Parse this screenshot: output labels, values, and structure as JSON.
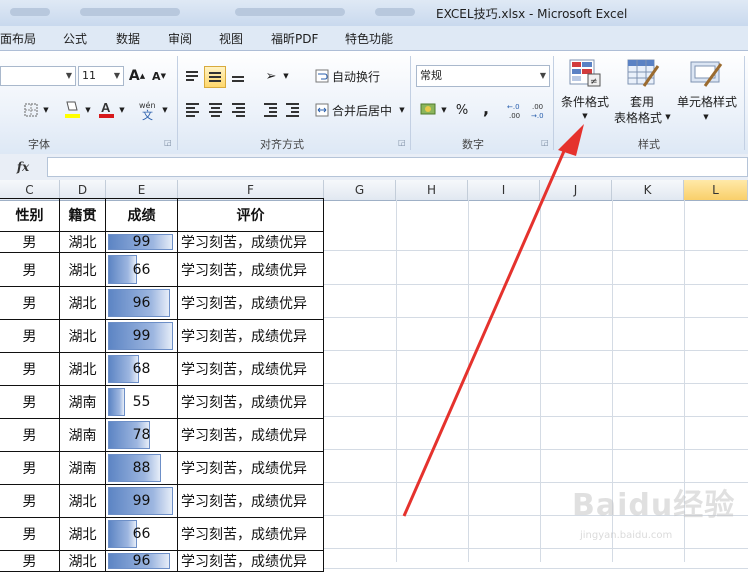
{
  "window": {
    "title": "EXCEL技巧.xlsx - Microsoft Excel"
  },
  "menu": [
    "面布局",
    "公式",
    "数据",
    "审阅",
    "视图",
    "福昕PDF",
    "特色功能"
  ],
  "font": {
    "size": "11",
    "grow": "A",
    "shrink": "A",
    "group_label": "字体"
  },
  "alignment": {
    "wrap_label": "自动换行",
    "merge_label": "合并后居中",
    "group_label": "对齐方式"
  },
  "number": {
    "format_value": "常规",
    "percent": "%",
    "comma": ",",
    "group_label": "数字"
  },
  "styles": {
    "conditional_label": "条件格式",
    "table_label_1": "套用",
    "table_label_2": "表格格式",
    "cell_styles_label": "单元格样式",
    "group_label": "样式"
  },
  "formula_bar": {
    "fx": "fx",
    "value": ""
  },
  "columns": [
    "C",
    "D",
    "E",
    "F",
    "G",
    "H",
    "I",
    "J",
    "K",
    "L"
  ],
  "table": {
    "headers": [
      "性别",
      "籍贯",
      "成绩",
      "评价"
    ],
    "rows": [
      [
        "男",
        "湖北",
        "99",
        "学习刻苦，成绩优异"
      ],
      [
        "男",
        "湖北",
        "66",
        "学习刻苦，成绩优异"
      ],
      [
        "男",
        "湖北",
        "96",
        "学习刻苦，成绩优异"
      ],
      [
        "男",
        "湖北",
        "99",
        "学习刻苦，成绩优异"
      ],
      [
        "男",
        "湖北",
        "68",
        "学习刻苦，成绩优异"
      ],
      [
        "男",
        "湖南",
        "55",
        "学习刻苦，成绩优异"
      ],
      [
        "男",
        "湖南",
        "78",
        "学习刻苦，成绩优异"
      ],
      [
        "男",
        "湖南",
        "88",
        "学习刻苦，成绩优异"
      ],
      [
        "男",
        "湖北",
        "99",
        "学习刻苦，成绩优异"
      ],
      [
        "男",
        "湖北",
        "66",
        "学习刻苦，成绩优异"
      ],
      [
        "男",
        "湖北",
        "96",
        "学习刻苦，成绩优异"
      ]
    ]
  },
  "watermark": {
    "brand": "Baidu经验",
    "url": "jingyan.baidu.com"
  },
  "colors": {
    "arrow": "#e5322d",
    "databar": "#5d85c4",
    "selected_column": "#f9cf6a"
  }
}
